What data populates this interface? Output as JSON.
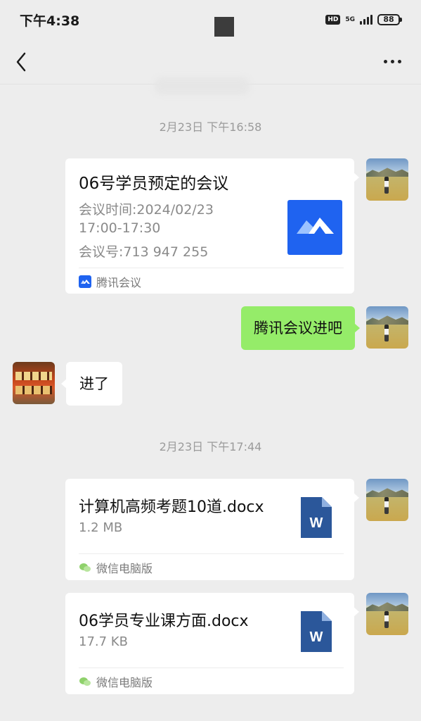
{
  "status_bar": {
    "time": "下午4:38",
    "hd": "HD",
    "network": "5G",
    "battery": "88"
  },
  "nav": {
    "back_icon": "chevron-left-icon",
    "more_icon": "more-dots-icon"
  },
  "messages": {
    "time_1": "2月23日 下午16:58",
    "meeting_card": {
      "title": "06号学员预定的会议",
      "time_line": "会议时间:2024/02/23",
      "range_line": "17:00-17:30",
      "id_line": "会议号:713 947 255",
      "source": "腾讯会议",
      "logo_color": "#1f63f0"
    },
    "sent_text": "腾讯会议进吧",
    "received_text": "进了",
    "time_2": "2月23日 下午17:44",
    "file_1": {
      "name": "计算机高频考题10道.docx",
      "size": "1.2 MB",
      "source": "微信电脑版",
      "icon_letter": "W"
    },
    "file_2": {
      "name": "06学员专业课方面.docx",
      "size": "17.7 KB",
      "source": "微信电脑版",
      "icon_letter": "W"
    }
  },
  "colors": {
    "sent_bubble": "#95ec69",
    "background": "#ededed",
    "word_blue": "#2b579a"
  }
}
